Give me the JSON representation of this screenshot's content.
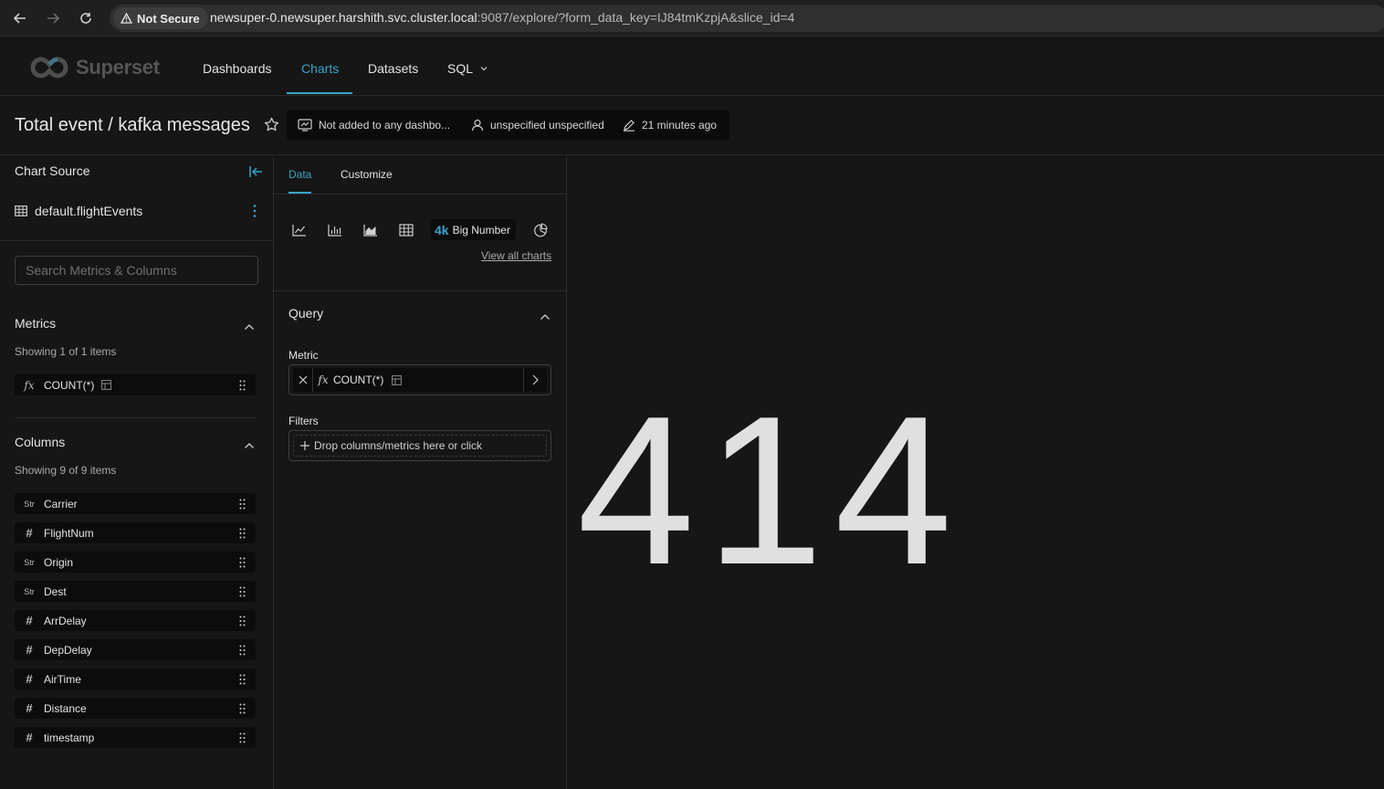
{
  "browser": {
    "security_label": "Not Secure",
    "url_host": "newsuper-0.newsuper.harshith.svc.cluster.local",
    "url_rest": ":9087/explore/?form_data_key=IJ84tmKzpjA&slice_id=4"
  },
  "nav": {
    "brand": "Superset",
    "items": [
      "Dashboards",
      "Charts",
      "Datasets",
      "SQL"
    ],
    "active": "Charts"
  },
  "header": {
    "title": "Total event / kafka messages",
    "dashboards": "Not added to any dashbo...",
    "owner": "unspecified unspecified",
    "modified": "21 minutes ago"
  },
  "datasource": {
    "section_title": "Chart Source",
    "name": "default.flightEvents",
    "search_placeholder": "Search Metrics & Columns"
  },
  "metrics": {
    "title": "Metrics",
    "count_text": "Showing 1 of 1 items",
    "items": [
      {
        "type": "fx",
        "name": "COUNT(*)"
      }
    ]
  },
  "columns": {
    "title": "Columns",
    "count_text": "Showing 9 of 9 items",
    "items": [
      {
        "type": "str",
        "name": "Carrier"
      },
      {
        "type": "num",
        "name": "FlightNum"
      },
      {
        "type": "str",
        "name": "Origin"
      },
      {
        "type": "str",
        "name": "Dest"
      },
      {
        "type": "num",
        "name": "ArrDelay"
      },
      {
        "type": "num",
        "name": "DepDelay"
      },
      {
        "type": "num",
        "name": "AirTime"
      },
      {
        "type": "num",
        "name": "Distance"
      },
      {
        "type": "num",
        "name": "timestamp"
      }
    ]
  },
  "control_panel": {
    "tabs": [
      "Data",
      "Customize"
    ],
    "active_tab": "Data",
    "chart_type_icons": [
      "line-chart-icon",
      "bar-chart-icon",
      "area-chart-icon",
      "table-chart-icon",
      "big-number-icon",
      "pie-chart-icon"
    ],
    "big_number_icon_text": "4k",
    "big_number_label": "Big Number",
    "view_all": "View all charts",
    "query_title": "Query",
    "metric_label": "Metric",
    "metric_value": "COUNT(*)",
    "filters_label": "Filters",
    "filters_placeholder": "Drop columns/metrics here or click"
  },
  "chart": {
    "big_number": "414"
  },
  "colors": {
    "accent": "#3aa3c7",
    "background": "#161616"
  }
}
